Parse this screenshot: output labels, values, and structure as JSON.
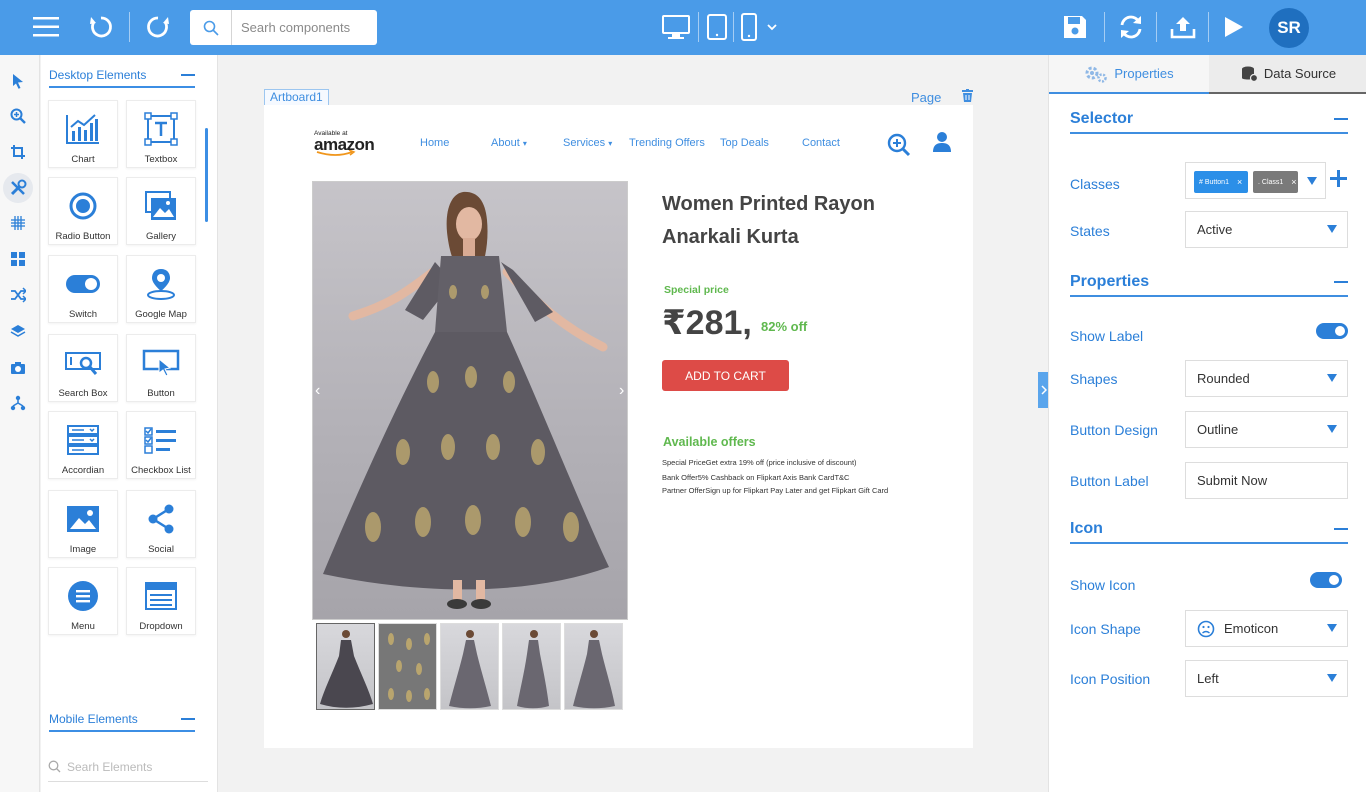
{
  "topbar": {
    "search_placeholder": "Searh components",
    "avatar_initials": "SR",
    "accent_color": "#4a9be8"
  },
  "elements_panel": {
    "desktop_title": "Desktop Elements",
    "items": [
      {
        "label": "Chart",
        "icon": "chart-icon"
      },
      {
        "label": "Textbox",
        "icon": "textbox-icon"
      },
      {
        "label": "Radio Button",
        "icon": "radio-button-icon"
      },
      {
        "label": "Gallery",
        "icon": "gallery-icon"
      },
      {
        "label": "Switch",
        "icon": "switch-icon"
      },
      {
        "label": "Google Map",
        "icon": "map-pin-icon"
      },
      {
        "label": "Search Box",
        "icon": "search-box-icon"
      },
      {
        "label": "Button",
        "icon": "button-icon"
      },
      {
        "label": "Accordian",
        "icon": "accordion-icon"
      },
      {
        "label": "Checkbox List",
        "icon": "checkbox-list-icon"
      },
      {
        "label": "Image",
        "icon": "image-icon"
      },
      {
        "label": "Social",
        "icon": "share-icon"
      },
      {
        "label": "Menu",
        "icon": "menu-icon"
      },
      {
        "label": "Dropdown",
        "icon": "dropdown-icon"
      }
    ],
    "mobile_title": "Mobile Elements",
    "mobile_search_placeholder": "Searh Elements"
  },
  "canvas": {
    "artboard_label": "Artboard1",
    "page_label": "Page"
  },
  "product_page": {
    "logo_small": "Available at",
    "logo_big": "amazon",
    "nav": [
      "Home",
      "About",
      "Services",
      "Trending Offers",
      "Top Deals",
      "Contact"
    ],
    "title": "Women Printed Rayon Anarkali Kurta",
    "special_price_label": "Special price",
    "price": "₹281,",
    "discount": "82% off",
    "add_to_cart": "ADD TO CART",
    "offers_title": "Available offers",
    "offers": [
      "Special PriceGet extra 19% off (price inclusive of discount)",
      "Bank Offer5% Cashback on Flipkart Axis Bank CardT&C",
      "Partner OfferSign up for Flipkart Pay Later and get Flipkart Gift Card"
    ],
    "prev_arrow": "‹",
    "next_arrow": "›"
  },
  "right_panel": {
    "tabs": {
      "properties": "Properties",
      "data_source": "Data Source"
    },
    "selector": {
      "title": "Selector",
      "classes_label": "Classes",
      "chip1": "# Button1",
      "chip2": ". Class1",
      "chip_close": "×",
      "states_label": "States",
      "states_value": "Active"
    },
    "properties": {
      "title": "Properties",
      "show_label": "Show Label",
      "show_label_on": true,
      "shapes_label": "Shapes",
      "shapes_value": "Rounded",
      "button_design_label": "Button Design",
      "button_design_value": "Outline",
      "button_label_label": "Button Label",
      "button_label_value": "Submit Now"
    },
    "icon": {
      "title": "Icon",
      "show_icon": "Show Icon",
      "show_icon_on": true,
      "icon_shape_label": "Icon Shape",
      "icon_shape_value": "Emoticon",
      "icon_position_label": "Icon Position",
      "icon_position_value": "Left"
    }
  }
}
